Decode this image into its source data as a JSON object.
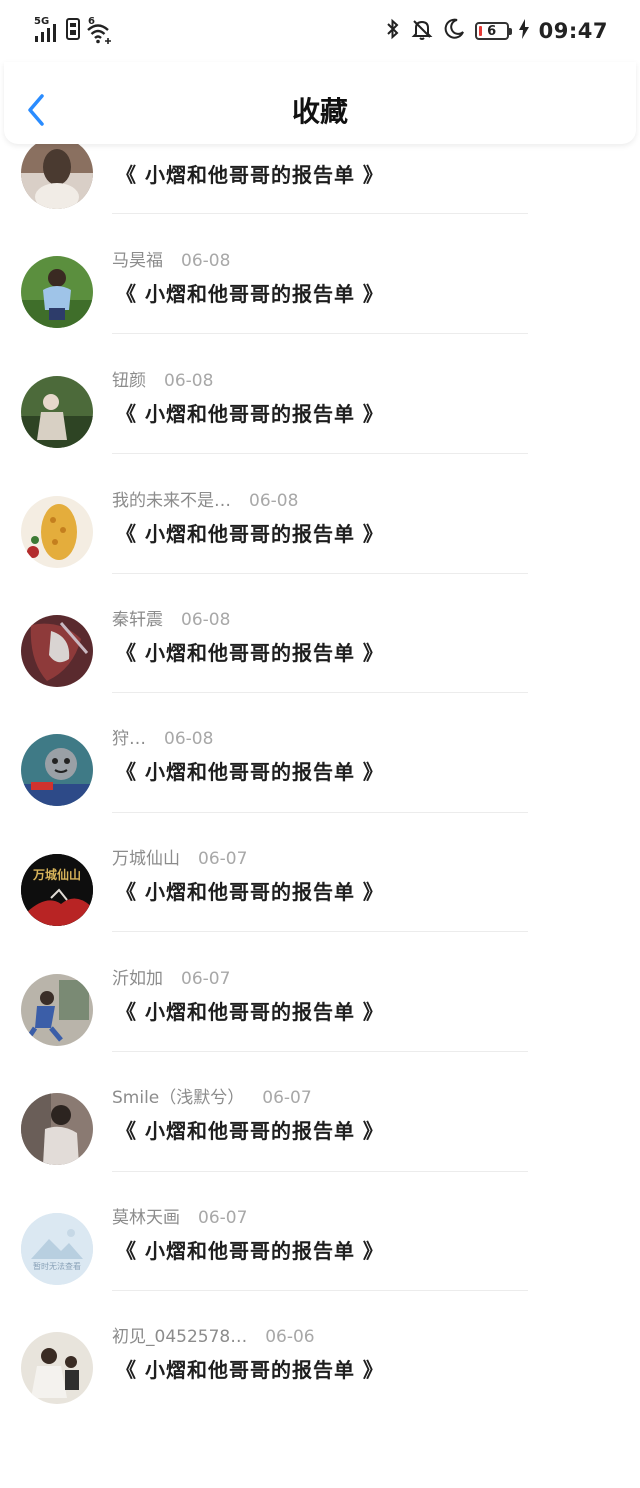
{
  "status_bar": {
    "network": "5G",
    "wifi_badge": "6",
    "battery_level": "6",
    "time": "09:47",
    "icons": [
      "signal-icon",
      "sim-icon",
      "wifi-icon",
      "bluetooth-icon",
      "mute-bell-icon",
      "moon-icon",
      "battery-icon",
      "charging-icon"
    ]
  },
  "header": {
    "title": "收藏",
    "back_icon": "chevron-left-icon"
  },
  "accent_color": "#2a8cff",
  "items": [
    {
      "name": "",
      "date": "",
      "title": "《 小熠和他哥哥的报告单 》"
    },
    {
      "name": "马昊福",
      "date": "06-08",
      "title": "《 小熠和他哥哥的报告单 》"
    },
    {
      "name": "钮颜",
      "date": "06-08",
      "title": "《 小熠和他哥哥的报告单 》"
    },
    {
      "name": "我的未来不是…",
      "date": "06-08",
      "title": "《 小熠和他哥哥的报告单 》"
    },
    {
      "name": "秦轩震",
      "date": "06-08",
      "title": "《 小熠和他哥哥的报告单 》"
    },
    {
      "name": "狩…",
      "date": "06-08",
      "title": "《 小熠和他哥哥的报告单 》"
    },
    {
      "name": "万城仙山",
      "date": "06-07",
      "title": "《 小熠和他哥哥的报告单 》",
      "avatar_text": "万城仙山"
    },
    {
      "name": "沂如加",
      "date": "06-07",
      "title": "《 小熠和他哥哥的报告单 》"
    },
    {
      "name": "Smile（浅默兮）",
      "date": "06-07",
      "title": "《 小熠和他哥哥的报告单 》"
    },
    {
      "name": "莫林天画",
      "date": "06-07",
      "title": "《 小熠和他哥哥的报告单 》",
      "avatar_text": "暂时无法查看"
    },
    {
      "name": "初见_0452578…",
      "date": "06-06",
      "title": "《 小熠和他哥哥的报告单 》"
    }
  ]
}
